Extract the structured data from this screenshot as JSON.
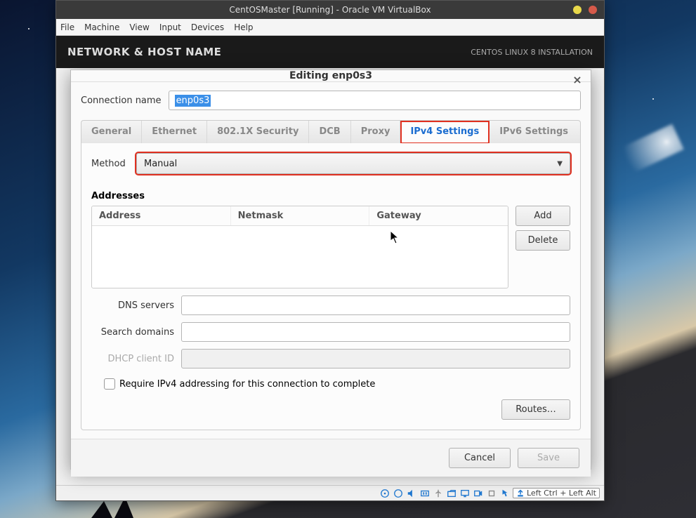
{
  "vb": {
    "title": "CentOSMaster [Running] - Oracle VM VirtualBox",
    "menus": [
      "File",
      "Machine",
      "View",
      "Input",
      "Devices",
      "Help"
    ],
    "host_key": "Left Ctrl + Left Alt"
  },
  "anaconda": {
    "left_header": "NETWORK & HOST NAME",
    "right_header": "CENTOS LINUX 8 INSTALLATION"
  },
  "dialog": {
    "title": "Editing enp0s3",
    "connection_label": "Connection name",
    "connection_value": "enp0s3",
    "tabs": [
      "General",
      "Ethernet",
      "802.1X Security",
      "DCB",
      "Proxy",
      "IPv4 Settings",
      "IPv6 Settings"
    ],
    "active_tab": 5,
    "method_label": "Method",
    "method_value": "Manual",
    "addresses_label": "Addresses",
    "addr_cols": [
      "Address",
      "Netmask",
      "Gateway"
    ],
    "add_btn": "Add",
    "delete_btn": "Delete",
    "dns_label": "DNS servers",
    "search_label": "Search domains",
    "dhcp_label": "DHCP client ID",
    "require_label": "Require IPv4 addressing for this connection to complete",
    "routes_btn": "Routes…",
    "cancel": "Cancel",
    "save": "Save"
  }
}
